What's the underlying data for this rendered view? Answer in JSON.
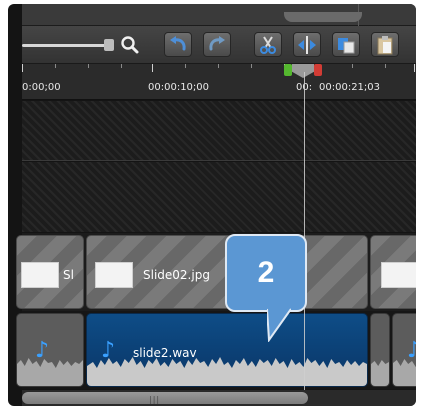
{
  "ruler": {
    "labels": [
      "0:00;00",
      "00:00:10;00",
      "00:",
      "00:00:21;03"
    ]
  },
  "clips": {
    "image": [
      {
        "label": "Sl"
      },
      {
        "label": "Slide02.jpg"
      },
      {
        "label": ""
      }
    ],
    "audio": [
      {
        "label": ""
      },
      {
        "label": "slide2.wav"
      },
      {
        "label": ""
      }
    ]
  },
  "callout": {
    "number": "2"
  },
  "colors": {
    "accent_blue": "#5b97d3",
    "clip_blue": "#0e4d87",
    "in_marker": "#55b82f",
    "out_marker": "#d23c35"
  },
  "icons": {
    "zoom": "magnifier-icon",
    "undo": "undo-icon",
    "redo": "redo-icon",
    "cut": "scissors-icon",
    "split": "split-icon",
    "copy": "copy-icon",
    "paste": "paste-icon",
    "audio": "music-note-icon"
  }
}
